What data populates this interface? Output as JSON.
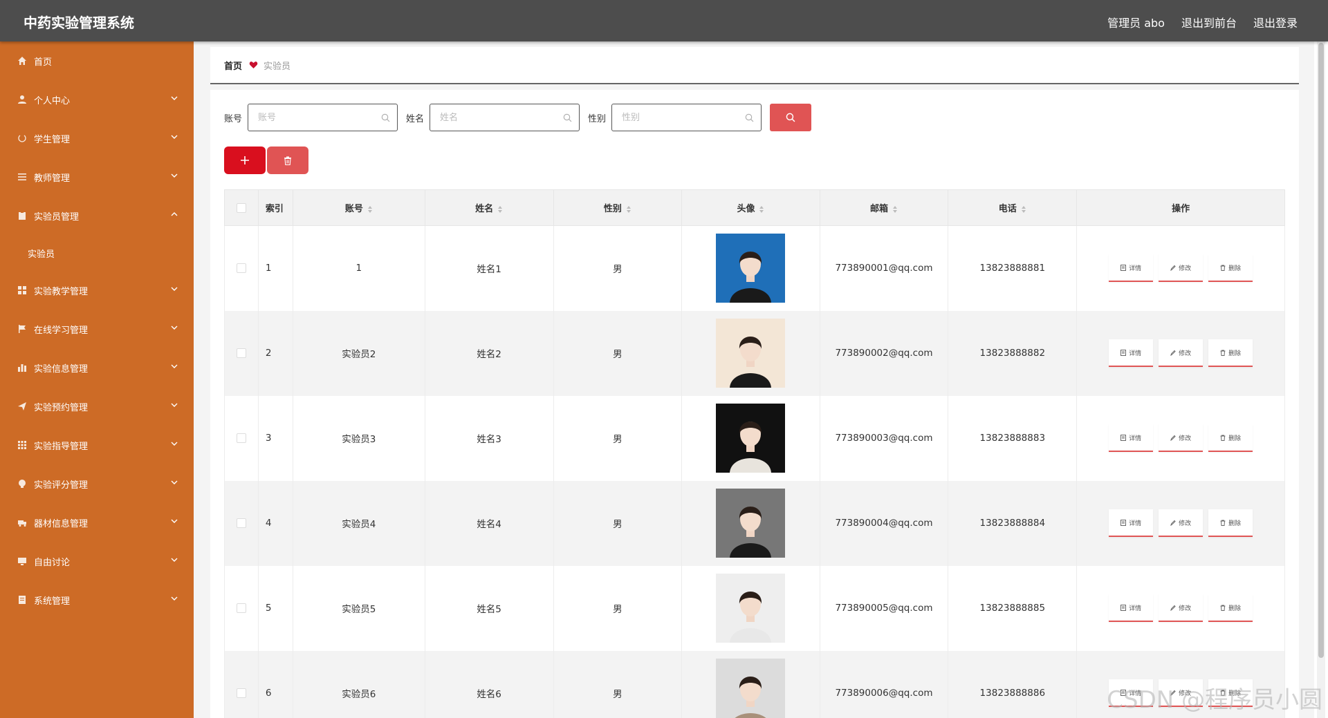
{
  "header": {
    "title": "中药实验管理系统",
    "user": "管理员 abo",
    "to_front": "退出到前台",
    "logout": "退出登录"
  },
  "sidebar": {
    "items": [
      {
        "label": "首页",
        "icon": "home-icon",
        "expandable": false
      },
      {
        "label": "个人中心",
        "icon": "user-icon",
        "expandable": true
      },
      {
        "label": "学生管理",
        "icon": "power-icon",
        "expandable": true
      },
      {
        "label": "教师管理",
        "icon": "list-icon",
        "expandable": true
      },
      {
        "label": "实验员管理",
        "icon": "clipboard-icon",
        "expandable": true,
        "expanded": true,
        "children": [
          "实验员"
        ]
      },
      {
        "label": "实验教学管理",
        "icon": "grid-icon",
        "expandable": true
      },
      {
        "label": "在线学习管理",
        "icon": "flag-icon",
        "expandable": true
      },
      {
        "label": "实验信息管理",
        "icon": "chart-icon",
        "expandable": true
      },
      {
        "label": "实验预约管理",
        "icon": "send-icon",
        "expandable": true
      },
      {
        "label": "实验指导管理",
        "icon": "apps-icon",
        "expandable": true
      },
      {
        "label": "实验评分管理",
        "icon": "badge-icon",
        "expandable": true
      },
      {
        "label": "器材信息管理",
        "icon": "truck-icon",
        "expandable": true
      },
      {
        "label": "自由讨论",
        "icon": "monitor-icon",
        "expandable": true
      },
      {
        "label": "系统管理",
        "icon": "doc-icon",
        "expandable": true
      }
    ]
  },
  "breadcrumb": {
    "home": "首页",
    "current": "实验员"
  },
  "search": {
    "account_label": "账号",
    "account_placeholder": "账号",
    "name_label": "姓名",
    "name_placeholder": "姓名",
    "gender_label": "性别",
    "gender_placeholder": "性别"
  },
  "table": {
    "headers": {
      "index": "索引",
      "account": "账号",
      "name": "姓名",
      "gender": "性别",
      "avatar": "头像",
      "email": "邮箱",
      "phone": "电话",
      "actions": "操作"
    },
    "action_labels": {
      "detail": "详情",
      "edit": "修改",
      "delete": "删除"
    },
    "rows": [
      {
        "index": "1",
        "account": "1",
        "name": "姓名1",
        "gender": "男",
        "email": "773890001@qq.com",
        "phone": "13823888881"
      },
      {
        "index": "2",
        "account": "实验员2",
        "name": "姓名2",
        "gender": "男",
        "email": "773890002@qq.com",
        "phone": "13823888882"
      },
      {
        "index": "3",
        "account": "实验员3",
        "name": "姓名3",
        "gender": "男",
        "email": "773890003@qq.com",
        "phone": "13823888883"
      },
      {
        "index": "4",
        "account": "实验员4",
        "name": "姓名4",
        "gender": "男",
        "email": "773890004@qq.com",
        "phone": "13823888884"
      },
      {
        "index": "5",
        "account": "实验员5",
        "name": "姓名5",
        "gender": "男",
        "email": "773890005@qq.com",
        "phone": "13823888885"
      },
      {
        "index": "6",
        "account": "实验员6",
        "name": "姓名6",
        "gender": "男",
        "email": "773890006@qq.com",
        "phone": "13823888886"
      }
    ]
  },
  "watermark": "CSDN @程序员小圆",
  "colors": {
    "topbar": "#4d4d4d",
    "sidebar": "#cd6b26",
    "accent_red": "#e05454",
    "add_red": "#d90f1e"
  }
}
